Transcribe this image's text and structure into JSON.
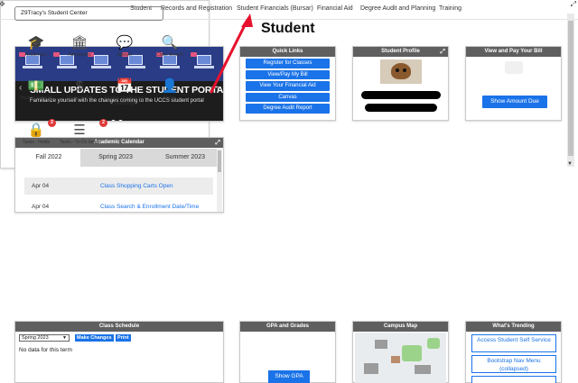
{
  "topnav": {
    "items": [
      "Student",
      "Records and Registration",
      "Student Financials (Bursar)",
      "Financial Aid",
      "Degree Audit and Planning",
      "Training"
    ]
  },
  "page": {
    "title": "Student"
  },
  "banner": {
    "headline": "SMALL UPDATES TO THE STUDENT PORTAL",
    "subtitle": "Familiarize yourself with the changes coming to the UCCS student portal",
    "slide_count": 2,
    "active_slide": 2
  },
  "quick_links": {
    "title": "Quick Links",
    "links": [
      "Register for Classes",
      "View/Pay My Bill",
      "View Your Financial Aid",
      "Canvas",
      "Degree Audit Report"
    ]
  },
  "profile": {
    "title": "Student Profile"
  },
  "bill": {
    "title": "View and Pay Your Bill",
    "button": "Show Amount Due"
  },
  "calendar": {
    "title": "Academic Calendar",
    "tabs": [
      "Fall 2022",
      "Spring 2023",
      "Summer 2023"
    ],
    "active_tab": 0,
    "rows": [
      {
        "date": "Apr 04",
        "event": "Class Shopping Carts Open"
      },
      {
        "date": "Apr 04",
        "event": "Class Search & Enrollment Date/Time"
      }
    ]
  },
  "student_center": {
    "title": "Z9Tracy's Student Center",
    "tiles": [
      {
        "label": "Academics",
        "icon": "graduation-cap-icon"
      },
      {
        "label": "Admissions",
        "icon": "institution-icon"
      },
      {
        "label": "Advisor",
        "icon": "chat-bubbles-icon"
      },
      {
        "label": "Class Search",
        "icon": "magnifier-icon"
      },
      {
        "label": "Student Account",
        "icon": "money-icon"
      },
      {
        "label": "Financial Aid",
        "icon": "dollar-icon"
      },
      {
        "label": "Register for Classes (add/drop)",
        "icon": "calendar-check-icon"
      },
      {
        "label": "Profile",
        "icon": "person-icon"
      },
      {
        "label": "Tasks - Holds",
        "icon": "lock-icon",
        "badge": "2"
      },
      {
        "label": "Tasks - To-Do Items",
        "icon": "list-icon",
        "badge": "2"
      }
    ]
  },
  "schedule": {
    "title": "Class Schedule",
    "term": "Spring 2023",
    "make_changes": "Make Changes",
    "print": "Print",
    "empty": "No data for this term"
  },
  "gpa": {
    "title": "GPA and Grades",
    "button": "Show GPA"
  },
  "map": {
    "title": "Campus Map"
  },
  "trending": {
    "title": "What's Trending",
    "items": [
      "Access Student Self Service",
      "Bootstrap Nav Menu (collapsed)"
    ]
  },
  "colors": {
    "accent": "#1a73e8",
    "header": "#5f5f5f",
    "annotation": "#e8112d",
    "badge": "#e03a3a"
  }
}
